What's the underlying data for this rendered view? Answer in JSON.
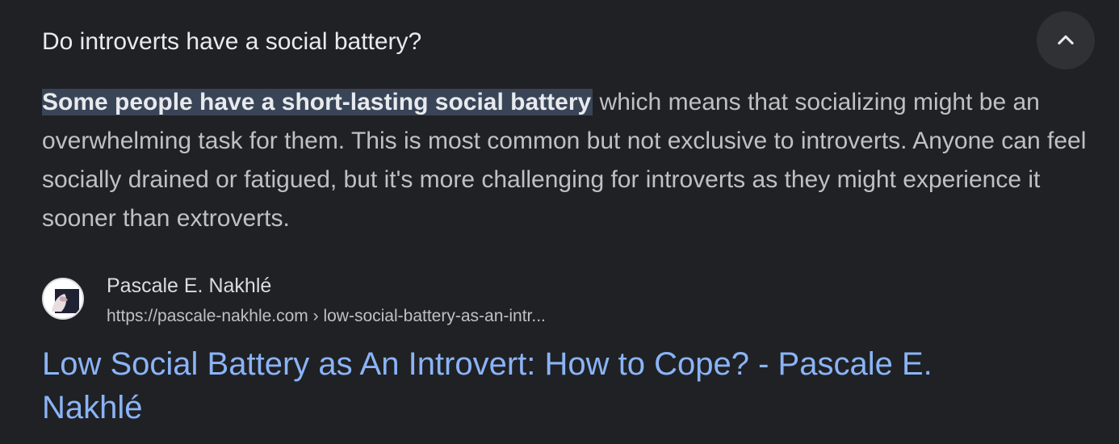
{
  "question": {
    "text": "Do introverts have a social battery?",
    "toggle_icon": "chevron-up-icon"
  },
  "answer": {
    "highlight": "Some people have a short-lasting social battery",
    "rest": " which means that socializing might be an overwhelming task for them. This is most common but not exclusive to introverts. Anyone can feel socially drained or fatigued, but it's more challenging for introverts as they might experience it sooner than extroverts."
  },
  "source": {
    "name": "Pascale E. Nakhlé",
    "url": "https://pascale-nakhle.com › low-social-battery-as-an-intr...",
    "favicon": "site-favicon-icon"
  },
  "result": {
    "title": "Low Social Battery as An Introvert: How to Cope? - Pascale E. Nakhlé"
  },
  "colors": {
    "background": "#202124",
    "link": "#8ab4f8",
    "highlight": "#394457",
    "button": "#303134"
  }
}
